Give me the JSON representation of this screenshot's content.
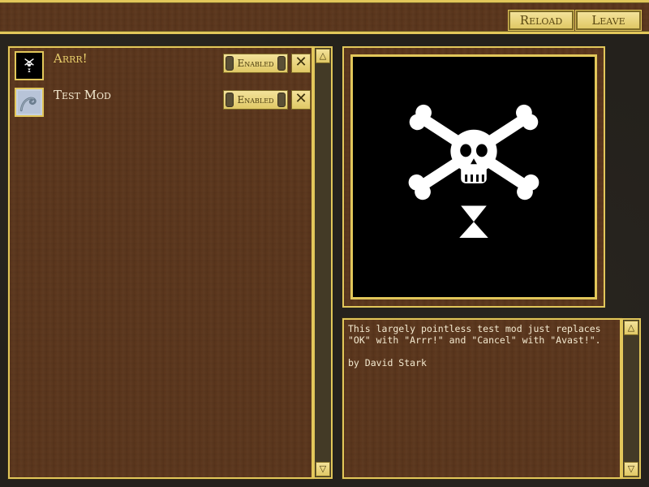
{
  "toolbar": {
    "reload_label": "Reload",
    "leave_label": "Leave"
  },
  "mods": [
    {
      "name": "Arrr!",
      "status": "Enabled",
      "icon": "jolly-roger-icon",
      "selected": true
    },
    {
      "name": "Test Mod",
      "status": "Enabled",
      "icon": "tentacle-icon",
      "selected": false
    }
  ],
  "description": {
    "line1": "This largely pointless test mod just replaces",
    "line2": "\"OK\" with \"Arrr!\" and \"Cancel\" with \"Avast!\".",
    "line3": "",
    "line4": "by David Stark"
  },
  "preview": {
    "icon": "jolly-roger-icon"
  },
  "colors": {
    "accent": "#e2c75a",
    "wood": "#5c371d",
    "text": "#f4ead0",
    "selected_text": "#e7cd6a"
  }
}
